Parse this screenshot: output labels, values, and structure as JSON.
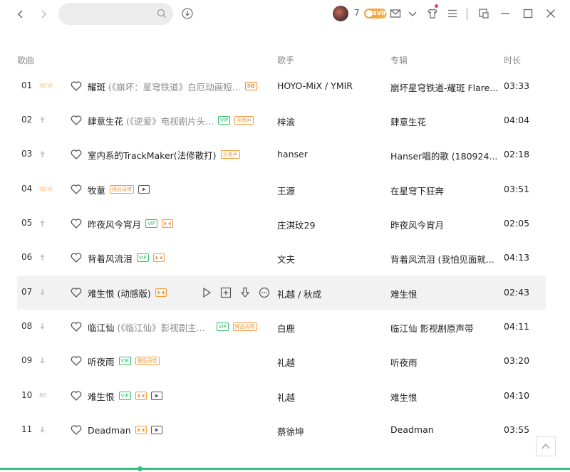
{
  "search": {
    "value": "",
    "placeholder": ""
  },
  "user": {
    "level": "7",
    "vip_badge": "SVIP"
  },
  "header": {
    "song": "歌曲",
    "artist": "歌手",
    "album": "专辑",
    "duration": "时长"
  },
  "tags": {
    "vip": "VIP",
    "quality": "臻品母带",
    "surround": "全景声",
    "sq": "SQ"
  },
  "rows": [
    {
      "num": "01",
      "trend": "NEW",
      "title": "耀斑",
      "subtitle": "(《崩坏：星穹铁道》白厄动画短...",
      "artist": "HOYO-MiX / YMIR",
      "album": "崩坏星穹铁道-耀斑 Flare...",
      "duration": "03:33"
    },
    {
      "num": "02",
      "trend": "",
      "title": "肆意生花",
      "subtitle": "(《逆爱》电视剧片头...",
      "artist": "梓渝",
      "album": "肆意生花",
      "duration": "04:04"
    },
    {
      "num": "03",
      "trend": "",
      "title": "室内系的TrackMaker(法修散打)",
      "subtitle": "",
      "artist": "hanser",
      "album": "Hanser唱的歌 (180924...",
      "duration": "02:18"
    },
    {
      "num": "04",
      "trend": "NEW",
      "title": "牧童",
      "subtitle": "",
      "artist": "王源",
      "album": "在星穹下狂奔",
      "duration": "03:51"
    },
    {
      "num": "05",
      "trend": "",
      "title": "昨夜风今宵月",
      "subtitle": "",
      "artist": "庄淇玟29",
      "album": "昨夜风今宵月",
      "duration": "02:05"
    },
    {
      "num": "06",
      "trend": "",
      "title": "背着风流泪",
      "subtitle": "",
      "artist": "文夫",
      "album": "背着风流泪 (我怕见面就...",
      "duration": "04:13"
    },
    {
      "num": "07",
      "trend": "",
      "title": "难生恨 (动感版)",
      "subtitle": "",
      "artist": "礼越 / 秋成",
      "album": "难生恨",
      "duration": "02:43"
    },
    {
      "num": "08",
      "trend": "",
      "title": "临江仙",
      "subtitle": "(《临江仙》影视剧主...",
      "artist": "白鹿",
      "album": "临江仙 影视剧原声带",
      "duration": "04:11"
    },
    {
      "num": "09",
      "trend": "",
      "title": "听夜雨",
      "subtitle": "",
      "artist": "礼越",
      "album": "听夜雨",
      "duration": "03:20"
    },
    {
      "num": "10",
      "trend": "RE",
      "title": "难生恨",
      "subtitle": "",
      "artist": "礼越",
      "album": "难生恨",
      "duration": "04:10"
    },
    {
      "num": "11",
      "trend": "",
      "title": "Deadman",
      "subtitle": "",
      "artist": "蔡徐坤",
      "album": "Deadman",
      "duration": "03:55"
    }
  ],
  "colors": {
    "accent": "#31c27c",
    "vip": "#2fbf6c",
    "orange": "#f29b3c",
    "new": "#f8c48a"
  }
}
